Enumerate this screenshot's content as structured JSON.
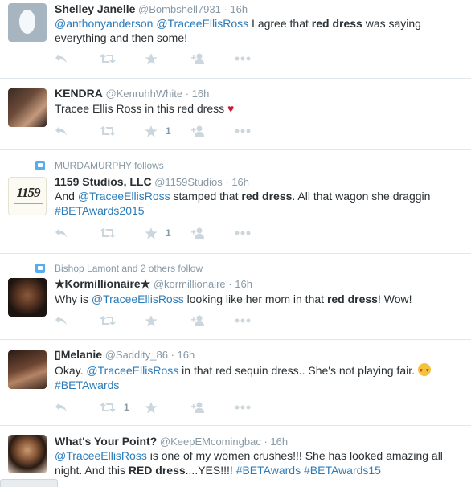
{
  "tweets": [
    {
      "name": "Shelley Janelle",
      "handle": "@Bombshell7931",
      "sep": "·",
      "time": "16h",
      "text": [
        {
          "t": "@anthonyanderson",
          "k": "mention"
        },
        {
          "t": " ",
          "k": "plain"
        },
        {
          "t": "@TraceeEllisRoss",
          "k": "mention"
        },
        {
          "t": " I agree that ",
          "k": "plain"
        },
        {
          "t": "red dress",
          "k": "bold"
        },
        {
          "t": " was saying everything and then some!",
          "k": "plain"
        }
      ],
      "retweet_count": "",
      "like_count": ""
    },
    {
      "name": "KENDRA",
      "handle": "@KenruhhWhite",
      "sep": "·",
      "time": "16h",
      "text": [
        {
          "t": "Tracee Ellis Ross in this red dress ",
          "k": "plain"
        },
        {
          "t": "♥",
          "k": "heart"
        }
      ],
      "retweet_count": "",
      "like_count": "1"
    },
    {
      "social": "MURDAMURPHY follows",
      "name": "1159 Studios, LLC",
      "handle": "@1159Studios",
      "sep": "·",
      "time": "16h",
      "text": [
        {
          "t": "And ",
          "k": "plain"
        },
        {
          "t": "@TraceeEllisRoss",
          "k": "mention"
        },
        {
          "t": " stamped that ",
          "k": "plain"
        },
        {
          "t": "red dress",
          "k": "bold"
        },
        {
          "t": ". All that wagon she draggin ",
          "k": "plain"
        },
        {
          "t": "#BETAwards2015",
          "k": "hashtag"
        }
      ],
      "retweet_count": "",
      "like_count": "1",
      "avatar_text": "1159"
    },
    {
      "social": "Bishop Lamont and 2 others follow",
      "name": "★Kormillionaire★",
      "handle": "@kormillionaire",
      "sep": "·",
      "time": "16h",
      "text": [
        {
          "t": "Why is ",
          "k": "plain"
        },
        {
          "t": "@TraceeEllisRoss",
          "k": "mention"
        },
        {
          "t": " looking like her mom in that ",
          "k": "plain"
        },
        {
          "t": "red dress",
          "k": "bold"
        },
        {
          "t": "! Wow!",
          "k": "plain"
        }
      ],
      "retweet_count": "",
      "like_count": ""
    },
    {
      "name": "Melanie",
      "handle": "@Saddity_86",
      "sep": "·",
      "time": "16h",
      "text": [
        {
          "t": "Okay. ",
          "k": "plain"
        },
        {
          "t": "@TraceeEllisRoss",
          "k": "mention"
        },
        {
          "t": " in that red sequin dress.. She's not playing fair. ",
          "k": "plain"
        },
        {
          "t": "",
          "k": "emoji"
        },
        {
          "t": " ",
          "k": "plain"
        },
        {
          "t": "#BETAwards",
          "k": "hashtag"
        }
      ],
      "retweet_count": "1",
      "like_count": ""
    },
    {
      "name": "What's Your Point?",
      "handle": "@KeepEMcomingbac",
      "sep": "·",
      "time": "16h",
      "text": [
        {
          "t": "@TraceeEllisRoss",
          "k": "mention"
        },
        {
          "t": " is one of my women crushes!!! She has looked amazing all night. And this ",
          "k": "plain"
        },
        {
          "t": "RED dress",
          "k": "bold"
        },
        {
          "t": "....YES!!!! ",
          "k": "plain"
        },
        {
          "t": "#BETAwards",
          "k": "hashtag"
        },
        {
          "t": " ",
          "k": "plain"
        },
        {
          "t": "#BETAwards15",
          "k": "hashtag"
        }
      ],
      "retweet_count": "",
      "like_count": ""
    }
  ],
  "colors": {
    "link": "#2b7bb9",
    "meta": "#8899a6",
    "icon": "#ccd6dd",
    "heart": "#cc1a33",
    "social_icon": "#55acee"
  }
}
